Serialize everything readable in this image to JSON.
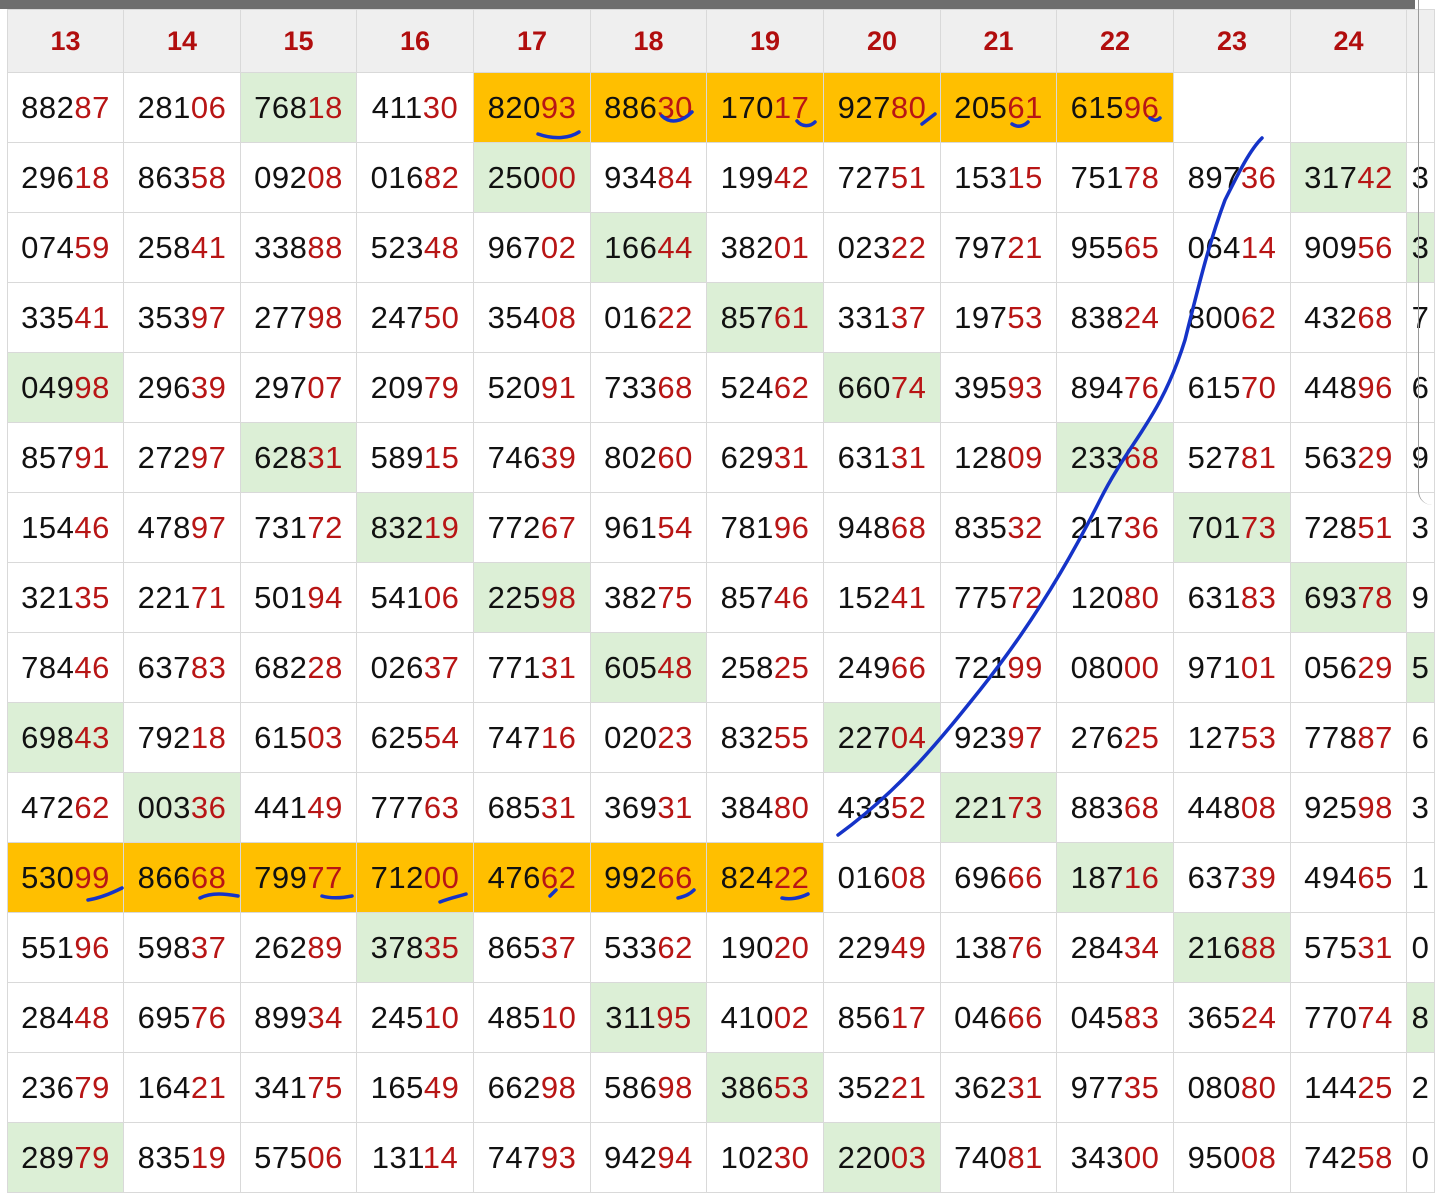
{
  "columns": [
    "13",
    "14",
    "15",
    "16",
    "17",
    "18",
    "19",
    "20",
    "21",
    "22",
    "23",
    "24",
    ""
  ],
  "rows": [
    [
      {
        "v": "88287",
        "c": ""
      },
      {
        "v": "28106",
        "c": ""
      },
      {
        "v": "76818",
        "c": "green"
      },
      {
        "v": "41130",
        "c": ""
      },
      {
        "v": "82093",
        "c": "orange"
      },
      {
        "v": "88630",
        "c": "orange"
      },
      {
        "v": "17017",
        "c": "orange"
      },
      {
        "v": "92780",
        "c": "orange"
      },
      {
        "v": "20561",
        "c": "orange"
      },
      {
        "v": "61596",
        "c": "orange"
      },
      {
        "v": "",
        "c": ""
      },
      {
        "v": "",
        "c": ""
      },
      {
        "v": "",
        "c": ""
      }
    ],
    [
      {
        "v": "29618",
        "c": ""
      },
      {
        "v": "86358",
        "c": ""
      },
      {
        "v": "09208",
        "c": ""
      },
      {
        "v": "01682",
        "c": ""
      },
      {
        "v": "25000",
        "c": "green"
      },
      {
        "v": "93484",
        "c": ""
      },
      {
        "v": "19942",
        "c": ""
      },
      {
        "v": "72751",
        "c": ""
      },
      {
        "v": "15315",
        "c": ""
      },
      {
        "v": "75178",
        "c": ""
      },
      {
        "v": "89736",
        "c": ""
      },
      {
        "v": "31742",
        "c": "green"
      },
      {
        "v": "3",
        "c": ""
      }
    ],
    [
      {
        "v": "07459",
        "c": ""
      },
      {
        "v": "25841",
        "c": ""
      },
      {
        "v": "33888",
        "c": ""
      },
      {
        "v": "52348",
        "c": ""
      },
      {
        "v": "96702",
        "c": ""
      },
      {
        "v": "16644",
        "c": "green"
      },
      {
        "v": "38201",
        "c": ""
      },
      {
        "v": "02322",
        "c": ""
      },
      {
        "v": "79721",
        "c": ""
      },
      {
        "v": "95565",
        "c": ""
      },
      {
        "v": "06414",
        "c": ""
      },
      {
        "v": "90956",
        "c": ""
      },
      {
        "v": "3",
        "c": "green"
      }
    ],
    [
      {
        "v": "33541",
        "c": ""
      },
      {
        "v": "35397",
        "c": ""
      },
      {
        "v": "27798",
        "c": ""
      },
      {
        "v": "24750",
        "c": ""
      },
      {
        "v": "35408",
        "c": ""
      },
      {
        "v": "01622",
        "c": ""
      },
      {
        "v": "85761",
        "c": "green"
      },
      {
        "v": "33137",
        "c": ""
      },
      {
        "v": "19753",
        "c": ""
      },
      {
        "v": "83824",
        "c": ""
      },
      {
        "v": "80062",
        "c": ""
      },
      {
        "v": "43268",
        "c": ""
      },
      {
        "v": "7",
        "c": ""
      }
    ],
    [
      {
        "v": "04998",
        "c": "green"
      },
      {
        "v": "29639",
        "c": ""
      },
      {
        "v": "29707",
        "c": ""
      },
      {
        "v": "20979",
        "c": ""
      },
      {
        "v": "52091",
        "c": ""
      },
      {
        "v": "73368",
        "c": ""
      },
      {
        "v": "52462",
        "c": ""
      },
      {
        "v": "66074",
        "c": "green"
      },
      {
        "v": "39593",
        "c": ""
      },
      {
        "v": "89476",
        "c": ""
      },
      {
        "v": "61570",
        "c": ""
      },
      {
        "v": "44896",
        "c": ""
      },
      {
        "v": "6",
        "c": ""
      }
    ],
    [
      {
        "v": "85791",
        "c": ""
      },
      {
        "v": "27297",
        "c": ""
      },
      {
        "v": "62831",
        "c": "green"
      },
      {
        "v": "58915",
        "c": ""
      },
      {
        "v": "74639",
        "c": ""
      },
      {
        "v": "80260",
        "c": ""
      },
      {
        "v": "62931",
        "c": ""
      },
      {
        "v": "63131",
        "c": ""
      },
      {
        "v": "12809",
        "c": ""
      },
      {
        "v": "23368",
        "c": "green"
      },
      {
        "v": "52781",
        "c": ""
      },
      {
        "v": "56329",
        "c": ""
      },
      {
        "v": "9",
        "c": ""
      }
    ],
    [
      {
        "v": "15446",
        "c": ""
      },
      {
        "v": "47897",
        "c": ""
      },
      {
        "v": "73172",
        "c": ""
      },
      {
        "v": "83219",
        "c": "green"
      },
      {
        "v": "77267",
        "c": ""
      },
      {
        "v": "96154",
        "c": ""
      },
      {
        "v": "78196",
        "c": ""
      },
      {
        "v": "94868",
        "c": ""
      },
      {
        "v": "83532",
        "c": ""
      },
      {
        "v": "21736",
        "c": ""
      },
      {
        "v": "70173",
        "c": "green"
      },
      {
        "v": "72851",
        "c": ""
      },
      {
        "v": "3",
        "c": ""
      }
    ],
    [
      {
        "v": "32135",
        "c": ""
      },
      {
        "v": "22171",
        "c": ""
      },
      {
        "v": "50194",
        "c": ""
      },
      {
        "v": "54106",
        "c": ""
      },
      {
        "v": "22598",
        "c": "green"
      },
      {
        "v": "38275",
        "c": ""
      },
      {
        "v": "85746",
        "c": ""
      },
      {
        "v": "15241",
        "c": ""
      },
      {
        "v": "77572",
        "c": ""
      },
      {
        "v": "12080",
        "c": ""
      },
      {
        "v": "63183",
        "c": ""
      },
      {
        "v": "69378",
        "c": "green"
      },
      {
        "v": "9",
        "c": ""
      }
    ],
    [
      {
        "v": "78446",
        "c": ""
      },
      {
        "v": "63783",
        "c": ""
      },
      {
        "v": "68228",
        "c": ""
      },
      {
        "v": "02637",
        "c": ""
      },
      {
        "v": "77131",
        "c": ""
      },
      {
        "v": "60548",
        "c": "green"
      },
      {
        "v": "25825",
        "c": ""
      },
      {
        "v": "24966",
        "c": ""
      },
      {
        "v": "72199",
        "c": ""
      },
      {
        "v": "08000",
        "c": ""
      },
      {
        "v": "97101",
        "c": ""
      },
      {
        "v": "05629",
        "c": ""
      },
      {
        "v": "5",
        "c": "green"
      }
    ],
    [
      {
        "v": "69843",
        "c": "green"
      },
      {
        "v": "79218",
        "c": ""
      },
      {
        "v": "61503",
        "c": ""
      },
      {
        "v": "62554",
        "c": ""
      },
      {
        "v": "74716",
        "c": ""
      },
      {
        "v": "02023",
        "c": ""
      },
      {
        "v": "83255",
        "c": ""
      },
      {
        "v": "22704",
        "c": "green"
      },
      {
        "v": "92397",
        "c": ""
      },
      {
        "v": "27625",
        "c": ""
      },
      {
        "v": "12753",
        "c": ""
      },
      {
        "v": "77887",
        "c": ""
      },
      {
        "v": "6",
        "c": ""
      }
    ],
    [
      {
        "v": "47262",
        "c": ""
      },
      {
        "v": "00336",
        "c": "green"
      },
      {
        "v": "44149",
        "c": ""
      },
      {
        "v": "77763",
        "c": ""
      },
      {
        "v": "68531",
        "c": ""
      },
      {
        "v": "36931",
        "c": ""
      },
      {
        "v": "38480",
        "c": ""
      },
      {
        "v": "43352",
        "c": ""
      },
      {
        "v": "22173",
        "c": "green"
      },
      {
        "v": "88368",
        "c": ""
      },
      {
        "v": "44808",
        "c": ""
      },
      {
        "v": "92598",
        "c": ""
      },
      {
        "v": "3",
        "c": ""
      }
    ],
    [
      {
        "v": "53099",
        "c": "orange"
      },
      {
        "v": "86668",
        "c": "orange"
      },
      {
        "v": "79977",
        "c": "orange"
      },
      {
        "v": "71200",
        "c": "orange"
      },
      {
        "v": "47662",
        "c": "orange"
      },
      {
        "v": "99266",
        "c": "orange"
      },
      {
        "v": "82422",
        "c": "orange"
      },
      {
        "v": "01608",
        "c": ""
      },
      {
        "v": "69666",
        "c": ""
      },
      {
        "v": "18716",
        "c": "green"
      },
      {
        "v": "63739",
        "c": ""
      },
      {
        "v": "49465",
        "c": ""
      },
      {
        "v": "1",
        "c": ""
      }
    ],
    [
      {
        "v": "55196",
        "c": ""
      },
      {
        "v": "59837",
        "c": ""
      },
      {
        "v": "26289",
        "c": ""
      },
      {
        "v": "37835",
        "c": "green"
      },
      {
        "v": "86537",
        "c": ""
      },
      {
        "v": "53362",
        "c": ""
      },
      {
        "v": "19020",
        "c": ""
      },
      {
        "v": "22949",
        "c": ""
      },
      {
        "v": "13876",
        "c": ""
      },
      {
        "v": "28434",
        "c": ""
      },
      {
        "v": "21688",
        "c": "green"
      },
      {
        "v": "57531",
        "c": ""
      },
      {
        "v": "0",
        "c": ""
      }
    ],
    [
      {
        "v": "28448",
        "c": ""
      },
      {
        "v": "69576",
        "c": ""
      },
      {
        "v": "89934",
        "c": ""
      },
      {
        "v": "24510",
        "c": ""
      },
      {
        "v": "48510",
        "c": ""
      },
      {
        "v": "31195",
        "c": "green"
      },
      {
        "v": "41002",
        "c": ""
      },
      {
        "v": "85617",
        "c": ""
      },
      {
        "v": "04666",
        "c": ""
      },
      {
        "v": "04583",
        "c": ""
      },
      {
        "v": "36524",
        "c": ""
      },
      {
        "v": "77074",
        "c": ""
      },
      {
        "v": "8",
        "c": "green"
      }
    ],
    [
      {
        "v": "23679",
        "c": ""
      },
      {
        "v": "16421",
        "c": ""
      },
      {
        "v": "34175",
        "c": ""
      },
      {
        "v": "16549",
        "c": ""
      },
      {
        "v": "66298",
        "c": ""
      },
      {
        "v": "58698",
        "c": ""
      },
      {
        "v": "38653",
        "c": "green"
      },
      {
        "v": "35221",
        "c": ""
      },
      {
        "v": "36231",
        "c": ""
      },
      {
        "v": "97735",
        "c": ""
      },
      {
        "v": "08080",
        "c": ""
      },
      {
        "v": "14425",
        "c": ""
      },
      {
        "v": "2",
        "c": ""
      }
    ],
    [
      {
        "v": "28979",
        "c": "green"
      },
      {
        "v": "83519",
        "c": ""
      },
      {
        "v": "57506",
        "c": ""
      },
      {
        "v": "13114",
        "c": ""
      },
      {
        "v": "74793",
        "c": ""
      },
      {
        "v": "94294",
        "c": ""
      },
      {
        "v": "10230",
        "c": ""
      },
      {
        "v": "22003",
        "c": "green"
      },
      {
        "v": "74081",
        "c": ""
      },
      {
        "v": "34300",
        "c": ""
      },
      {
        "v": "95008",
        "c": ""
      },
      {
        "v": "74258",
        "c": ""
      },
      {
        "v": "0",
        "c": ""
      }
    ]
  ],
  "colors": {
    "header_text": "#b10e0e",
    "tail_digits": "#b81515",
    "highlight_orange": "#ffbf00",
    "highlight_green": "#dcefd6",
    "ink_annotation": "#1533c8"
  }
}
